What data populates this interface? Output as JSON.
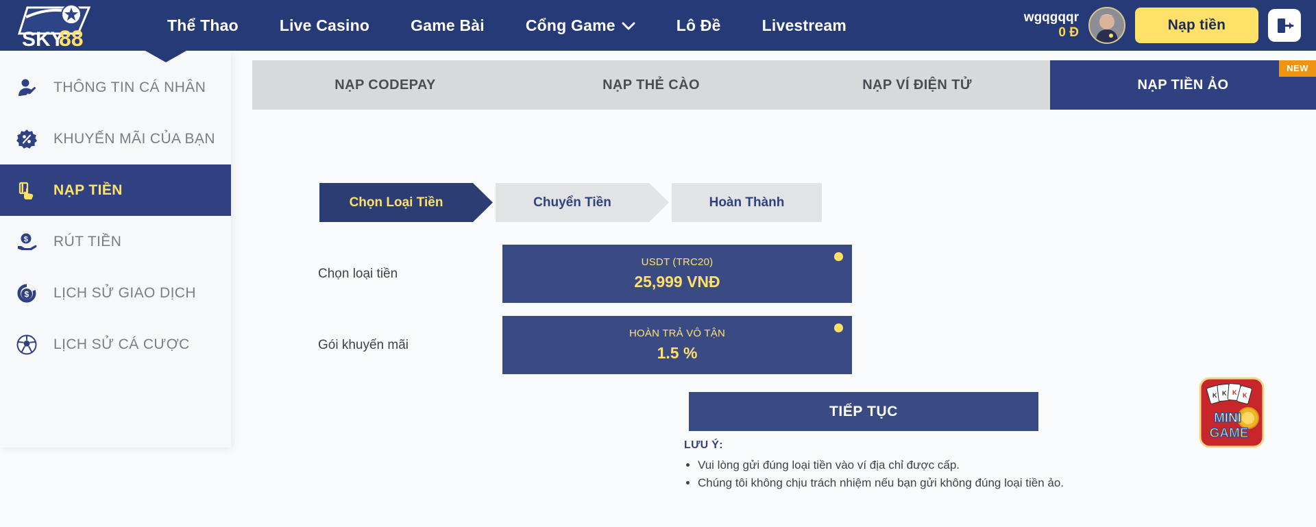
{
  "brand": {
    "name": "SKY88",
    "logo_text_1": "SKY",
    "logo_text_2": "88"
  },
  "header": {
    "nav": [
      {
        "label": "Thể Thao",
        "icon": "",
        "has_caret": false
      },
      {
        "label": "Live Casino",
        "icon": "",
        "has_caret": false
      },
      {
        "label": "Game Bài",
        "icon": "",
        "has_caret": false
      },
      {
        "label": "Cổng Game",
        "icon": "chevron-down-icon",
        "has_caret": true
      },
      {
        "label": "Lô Đề",
        "icon": "",
        "has_caret": false
      },
      {
        "label": "Livestream",
        "icon": "",
        "has_caret": false
      }
    ],
    "account": {
      "username": "wgqgqqr",
      "balance": "0 Đ",
      "avatar_icon": "avatar-icon"
    },
    "deposit_button": "Nạp tiền",
    "logout_icon": "logout-icon"
  },
  "sidebar": {
    "items": [
      {
        "label": "THÔNG TIN CÁ NHÂN",
        "icon": "user-edit-icon",
        "active": false
      },
      {
        "label": "KHUYẾN MÃI CỦA BẠN",
        "icon": "percent-badge-icon",
        "active": false
      },
      {
        "label": "NẠP TIỀN",
        "icon": "hand-card-icon",
        "active": true
      },
      {
        "label": "RÚT TIỀN",
        "icon": "hand-coin-icon",
        "active": false
      },
      {
        "label": "LỊCH SỬ GIAO DỊCH",
        "icon": "coin-history-icon",
        "active": false
      },
      {
        "label": "LỊCH SỬ CÁ CƯỢC",
        "icon": "football-icon",
        "active": false
      }
    ]
  },
  "tabs": [
    {
      "label": "NẠP CODEPAY",
      "active": false,
      "badge": ""
    },
    {
      "label": "NẠP THẺ CÀO",
      "active": false,
      "badge": ""
    },
    {
      "label": "NẠP VÍ ĐIỆN TỬ",
      "active": false,
      "badge": ""
    },
    {
      "label": "NẠP TIỀN ẢO",
      "active": true,
      "badge": "NEW"
    }
  ],
  "steps": [
    {
      "label": "Chọn Loại Tiền",
      "active": true
    },
    {
      "label": "Chuyển Tiền",
      "active": false
    },
    {
      "label": "Hoàn Thành",
      "active": false
    }
  ],
  "form": {
    "currency_row_label": "Chọn loại tiền",
    "currency_card": {
      "title": "USDT (TRC20)",
      "value": "25,999 VNĐ",
      "selected": true
    },
    "promo_row_label": "Gói khuyến mãi",
    "promo_card": {
      "title": "HOÀN TRẢ VÔ TẬN",
      "value": "1.5 %",
      "selected": true
    },
    "continue_button": "TIẾP TỤC"
  },
  "note": {
    "title": "LƯU Ý:",
    "items": [
      "Vui lòng gửi đúng loại tiền vào ví địa chỉ được cấp.",
      "Chúng tôi không chịu trách nhiệm nếu bạn gửi không đúng loại tiền ảo."
    ]
  },
  "minigame": {
    "label": "MINI GAME",
    "icon": "minigame-cards-icon"
  },
  "colors": {
    "header_navy": "#253a77",
    "panel_navy": "#2f4180",
    "card_navy": "#3a4b84",
    "accent_yellow": "#ffe169",
    "badge_orange": "#ef9312",
    "tab_gray": "#d8d9da"
  }
}
